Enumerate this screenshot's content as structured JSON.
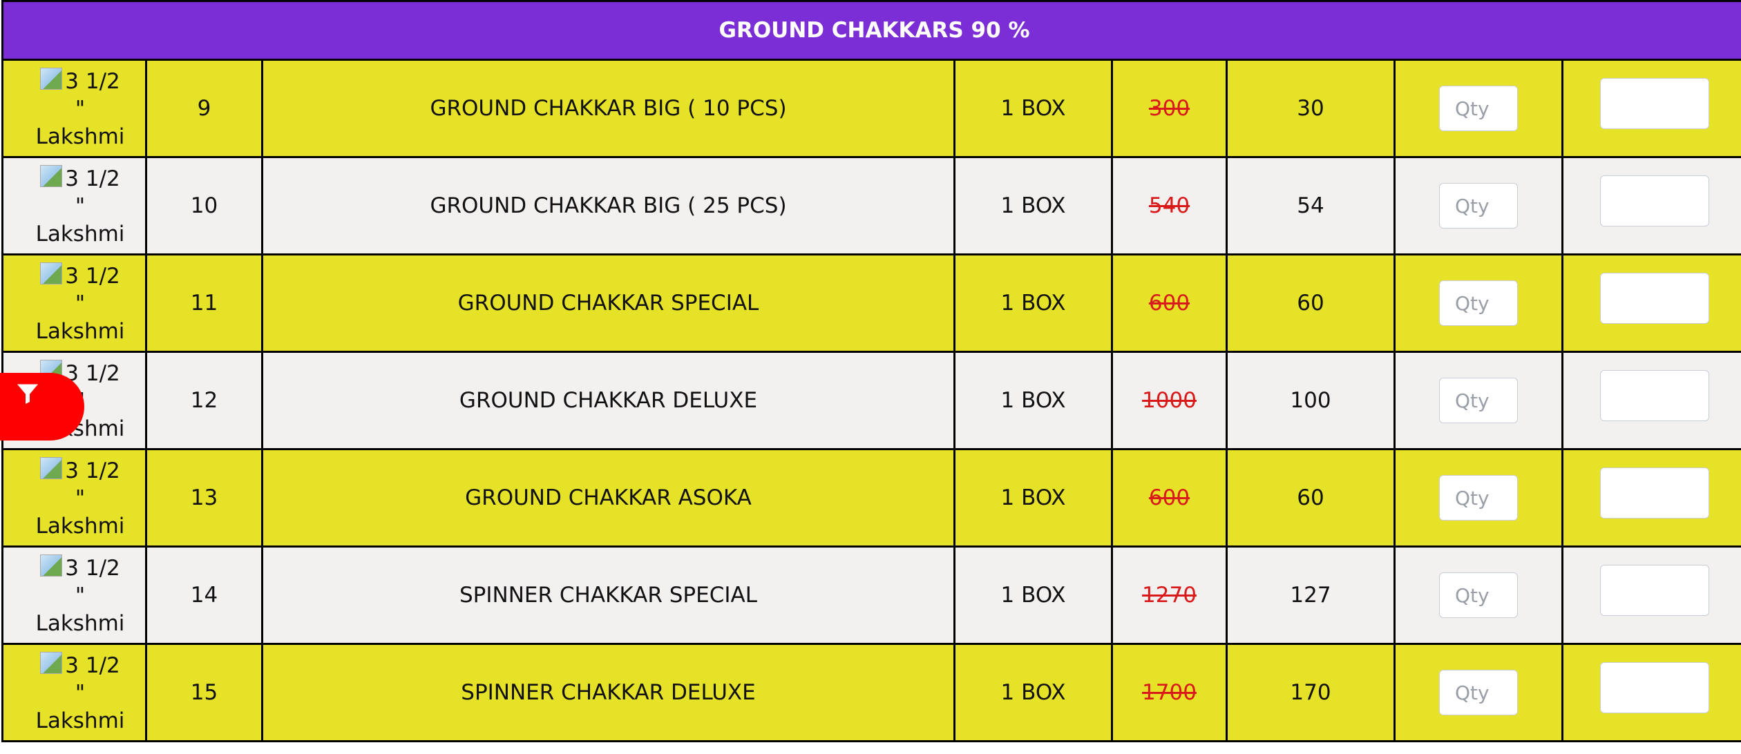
{
  "section": {
    "title": "GROUND CHAKKARS 90 %"
  },
  "rows": [
    {
      "img_alt": "3 1/2 \" Lakshmi",
      "sno": "9",
      "name": "GROUND CHAKKAR BIG ( 10 PCS)",
      "unit": "1 BOX",
      "mrp": "300",
      "price": "30",
      "qty_placeholder": "Qty"
    },
    {
      "img_alt": "3 1/2 \" Lakshmi",
      "sno": "10",
      "name": "GROUND CHAKKAR BIG ( 25 PCS)",
      "unit": "1 BOX",
      "mrp": "540",
      "price": "54",
      "qty_placeholder": "Qty"
    },
    {
      "img_alt": "3 1/2 \" Lakshmi",
      "sno": "11",
      "name": "GROUND CHAKKAR SPECIAL",
      "unit": "1 BOX",
      "mrp": "600",
      "price": "60",
      "qty_placeholder": "Qty"
    },
    {
      "img_alt": "3 1/2 \" Lakshmi",
      "sno": "12",
      "name": "GROUND CHAKKAR DELUXE",
      "unit": "1 BOX",
      "mrp": "1000",
      "price": "100",
      "qty_placeholder": "Qty"
    },
    {
      "img_alt": "3 1/2 \" Lakshmi",
      "sno": "13",
      "name": "GROUND CHAKKAR ASOKA",
      "unit": "1 BOX",
      "mrp": "600",
      "price": "60",
      "qty_placeholder": "Qty"
    },
    {
      "img_alt": "3 1/2 \" Lakshmi",
      "sno": "14",
      "name": "SPINNER CHAKKAR SPECIAL",
      "unit": "1 BOX",
      "mrp": "1270",
      "price": "127",
      "qty_placeholder": "Qty"
    },
    {
      "img_alt": "3 1/2 \" Lakshmi",
      "sno": "15",
      "name": "SPINNER CHAKKAR DELUXE",
      "unit": "1 BOX",
      "mrp": "1700",
      "price": "170",
      "qty_placeholder": "Qty"
    }
  ],
  "filter_button": {
    "icon": "filter-icon"
  },
  "colors": {
    "header_bg": "#7b2dd6",
    "row_yellow": "#e6e228",
    "row_white": "#f3f0f0",
    "mrp_strike": "#d81a1a",
    "filter_button": "#ff0000"
  }
}
